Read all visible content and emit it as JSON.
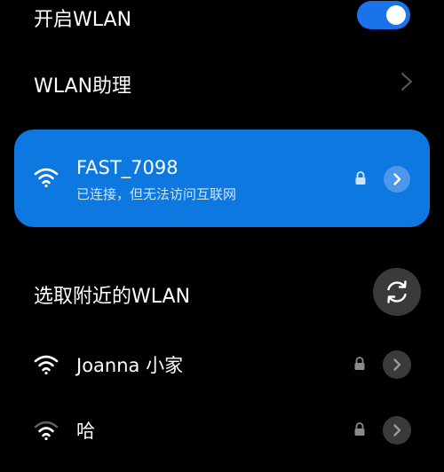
{
  "wlan_toggle": {
    "label": "开启WLAN",
    "enabled": true,
    "accent_color": "#1a73e8"
  },
  "assistant_row": {
    "label": "WLAN助理"
  },
  "connected_network": {
    "ssid": "FAST_7098",
    "status": "已连接，但无法访问互联网",
    "secured": true,
    "card_color": "#0d78e0",
    "icons": [
      "wifi-icon",
      "lock-icon",
      "chevron-right-icon"
    ]
  },
  "nearby_section": {
    "title": "选取附近的WLAN",
    "refresh_icon": "refresh-icon"
  },
  "nearby_networks": [
    {
      "name": "Joanna 小家",
      "secured": true,
      "signal": "full"
    },
    {
      "name": "哈",
      "secured": true,
      "signal": "weak"
    }
  ]
}
